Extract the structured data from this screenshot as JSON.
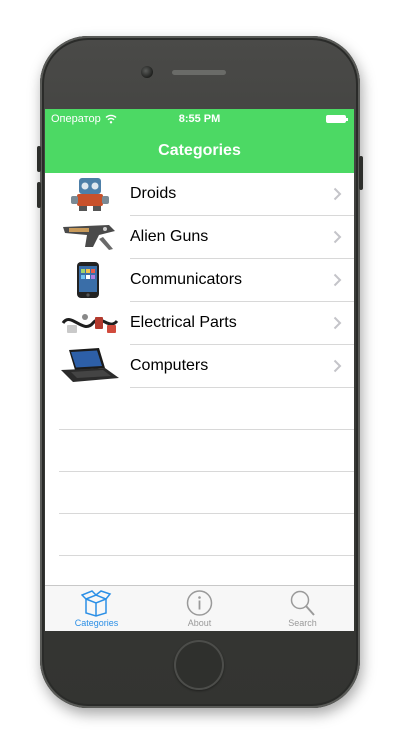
{
  "statusbar": {
    "carrier": "Оператор",
    "time": "8:55 PM"
  },
  "navbar": {
    "title": "Categories"
  },
  "categories": [
    {
      "label": "Droids",
      "icon": "droid-image"
    },
    {
      "label": "Alien Guns",
      "icon": "alien-gun-image"
    },
    {
      "label": "Communicators",
      "icon": "phone-image"
    },
    {
      "label": "Electrical Parts",
      "icon": "electrical-parts-image"
    },
    {
      "label": "Computers",
      "icon": "laptop-image"
    }
  ],
  "tabbar": {
    "tabs": [
      {
        "label": "Categories",
        "icon": "box-icon",
        "active": true
      },
      {
        "label": "About",
        "icon": "info-icon",
        "active": false
      },
      {
        "label": "Search",
        "icon": "search-icon",
        "active": false
      }
    ]
  },
  "colors": {
    "accent": "#4cd964",
    "tab_active": "#2b8fe6",
    "tab_inactive": "#9a9a9a",
    "phone_body": "#3a3b38"
  }
}
